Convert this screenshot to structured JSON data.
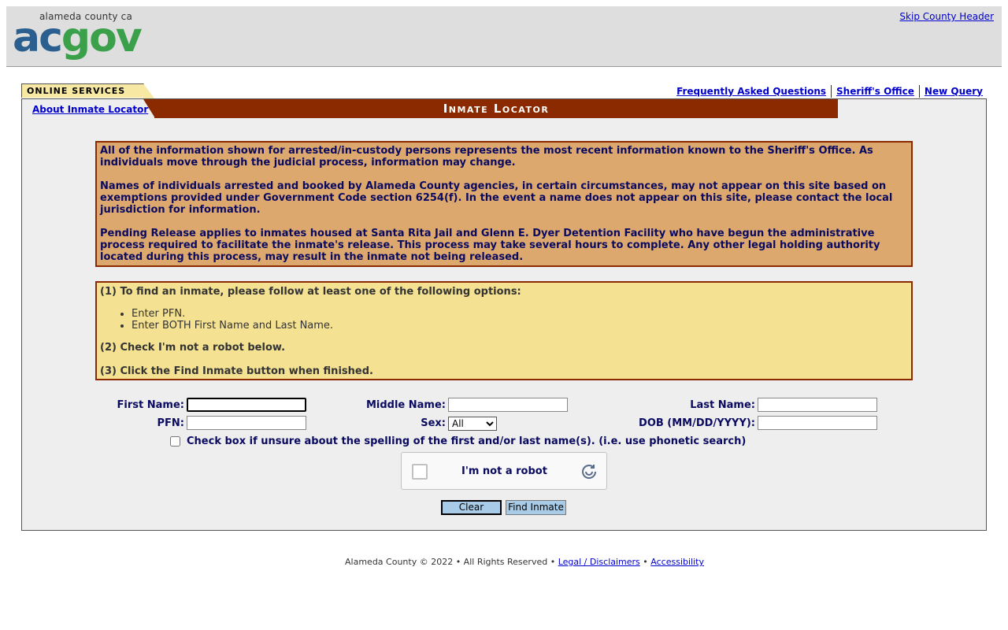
{
  "county_header": {
    "logo_small": "alameda county ca",
    "logo_ac": "ac",
    "logo_gov": "gov",
    "skip_link": "Skip County Header"
  },
  "nav": {
    "online_services_tab": "ONLINE SERVICES",
    "about_link": "About Inmate Locator",
    "title": "Inmate Locator",
    "links": [
      "Frequently Asked Questions",
      "Sheriff's Office",
      "New Query"
    ]
  },
  "info": {
    "paragraphs": [
      "All of the information shown for arrested/in-custody persons represents the most recent information known to the Sheriff's Office.  As individuals move through the judicial process, information may change.",
      "Names of individuals arrested and booked by Alameda County agencies, in certain circumstances, may not appear on this site based on exemptions provided under Government Code section 6254(f).  In the event a name does not appear on this site, please contact the local jurisdiction for information.",
      "Pending Release applies to inmates housed at Santa Rita Jail and Glenn E. Dyer Detention Facility who have begun the administrative process required to facilitate the inmate's release.  This process may take several hours to complete.  Any other legal holding authority located during this process, may result in the inmate not being released."
    ]
  },
  "instructions": {
    "step1": "(1) To find an inmate, please follow at least one of the following options:",
    "options": [
      "Enter PFN.",
      "Enter BOTH First Name and Last Name."
    ],
    "step2": "(2) Check I'm not a robot below.",
    "step3": "(3) Click the Find Inmate button when finished."
  },
  "form": {
    "first_name_label": "First Name:",
    "first_name_value": "",
    "middle_name_label": "Middle Name:",
    "middle_name_value": "",
    "last_name_label": "Last Name:",
    "last_name_value": "",
    "pfn_label": "PFN:",
    "pfn_value": "",
    "sex_label": "Sex:",
    "sex_selected": "All",
    "dob_label": "DOB (MM/DD/YYYY):",
    "dob_value": "",
    "phonetic_label": "Check box if unsure about the spelling of the first and/or last name(s). (i.e. use phonetic search)",
    "captcha_label": "I'm not a robot",
    "clear_button": "Clear",
    "find_button": "Find Inmate"
  },
  "footer": {
    "copyright": "Alameda County © 2022 • All Rights Reserved •",
    "legal_link": "Legal / Disclaimers",
    "separator": "•",
    "accessibility_link": "Accessibility"
  },
  "colors": {
    "title_bar": "#8b2a00",
    "info_bg": "#dca86e",
    "instr_bg": "#f4e192",
    "tab_bg": "#f7e9a3",
    "button_bg": "#a8cbe8",
    "logo_ac": "#2b5f8f",
    "logo_gov": "#3aa04a"
  }
}
